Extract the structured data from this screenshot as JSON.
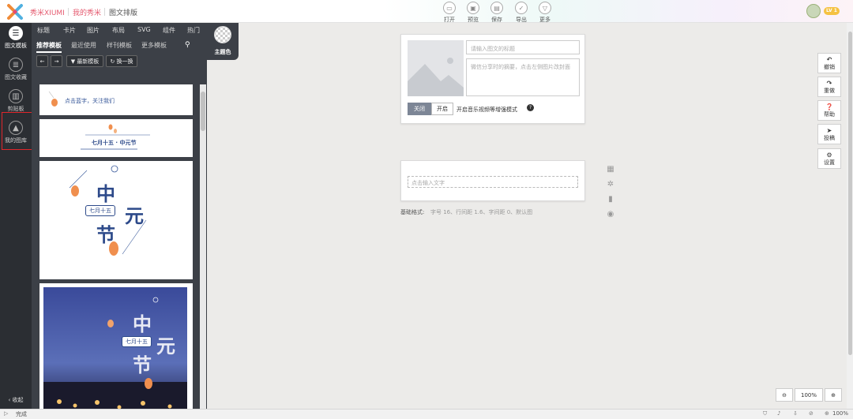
{
  "topbar": {
    "brand": "秀米XIUMI",
    "my_xiumi": "我的秀米",
    "title": "图文排版",
    "tools": [
      {
        "label": "打开",
        "icon": "folder-icon"
      },
      {
        "label": "预览",
        "icon": "preview-icon"
      },
      {
        "label": "保存",
        "icon": "save-icon"
      },
      {
        "label": "导出",
        "icon": "check-icon"
      },
      {
        "label": "更多",
        "icon": "chevron-down-icon"
      }
    ],
    "level_badge": "LV 1"
  },
  "rail": {
    "items": [
      {
        "label": "图文模板",
        "icon": "menu-icon"
      },
      {
        "label": "图文收藏",
        "icon": "document-icon"
      },
      {
        "label": "剪贴板",
        "icon": "clipboard-icon"
      },
      {
        "label": "我的图库",
        "icon": "image-icon"
      }
    ],
    "collapse": "收起"
  },
  "panel": {
    "categories": [
      "标题",
      "卡片",
      "图片",
      "布局",
      "SVG",
      "组件",
      "热门"
    ],
    "subtabs": [
      "推荐模板",
      "最近使用",
      "样刊模板",
      "更多模板"
    ],
    "filter_btn": "最新模板",
    "refresh_btn": "换一换",
    "cards": {
      "c1_text": "点击蓝字，关注我们",
      "c2_text": "七月十五 · 中元节",
      "c3_big": [
        "中",
        "元",
        "节"
      ],
      "c3_tag": "七月十五",
      "c4_big": [
        "中",
        "元",
        "节"
      ],
      "c4_tag": "七月十五"
    }
  },
  "theme": {
    "label": "主题色"
  },
  "editor": {
    "title_placeholder": "请输入图文的标题",
    "summary_placeholder": "微信分享时的摘要，点击左侧图片改封面",
    "toggle_off": "关闭",
    "toggle_on": "开启",
    "music_hint": "开启音乐视频等增强模式",
    "text_placeholder": "点击输入文字",
    "base_format": "基础格式:",
    "base_format_detail": "字号 16、行间距 1.6、字间距 0、默认图"
  },
  "right_actions": [
    {
      "label": "撤销",
      "icon": "undo-icon"
    },
    {
      "label": "重做",
      "icon": "redo-icon"
    },
    {
      "label": "帮助",
      "icon": "help-icon"
    },
    {
      "label": "投稿",
      "icon": "send-icon"
    },
    {
      "label": "设置",
      "icon": "gear-icon"
    }
  ],
  "zoom": {
    "minus": "⊖",
    "value": "100%",
    "plus": "⊕"
  },
  "status": {
    "text": "完成",
    "zoom": "100%"
  }
}
